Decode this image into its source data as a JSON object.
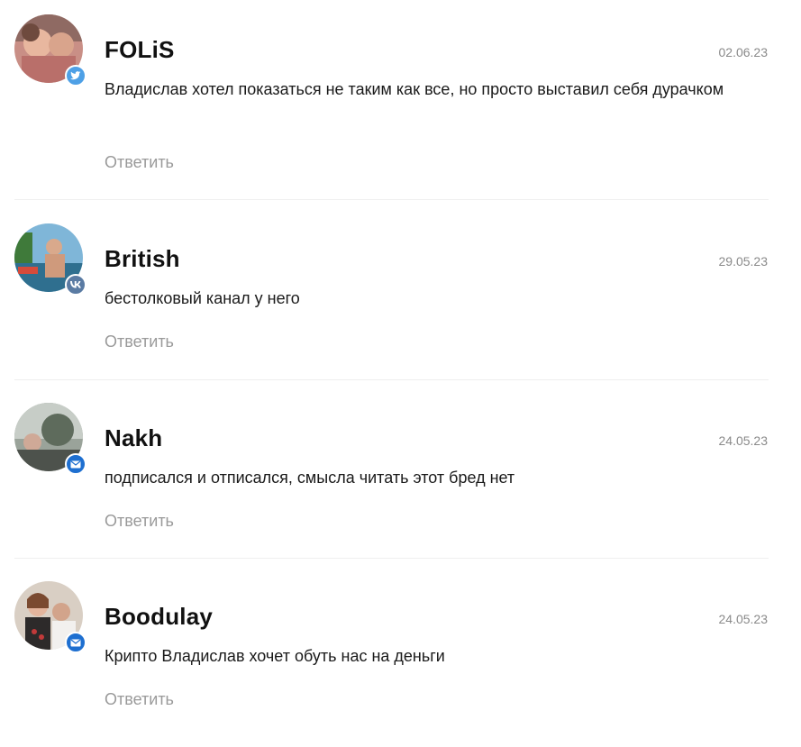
{
  "comments": [
    {
      "name": "FOLiS",
      "date": "02.06.23",
      "text": "Владислав хотел показаться не таким как все, но просто выставил себя дурачком",
      "reply_label": "Ответить",
      "source_icon": "twitter-icon",
      "badge_color": "#4ea0e6"
    },
    {
      "name": "British",
      "date": "29.05.23",
      "text": "бестолковый канал у него",
      "reply_label": "Ответить",
      "source_icon": "vk-icon",
      "badge_color": "#5a7ba3"
    },
    {
      "name": "Nakh",
      "date": "24.05.23",
      "text": "подписался и отписался, смысла читать этот бред нет",
      "reply_label": "Ответить",
      "source_icon": "mail-icon",
      "badge_color": "#1e6fd0"
    },
    {
      "name": "Boodulay",
      "date": "24.05.23",
      "text": "Крипто Владислав хочет обуть нас на деньги",
      "reply_label": "Ответить",
      "source_icon": "mail-icon",
      "badge_color": "#1e6fd0"
    }
  ]
}
